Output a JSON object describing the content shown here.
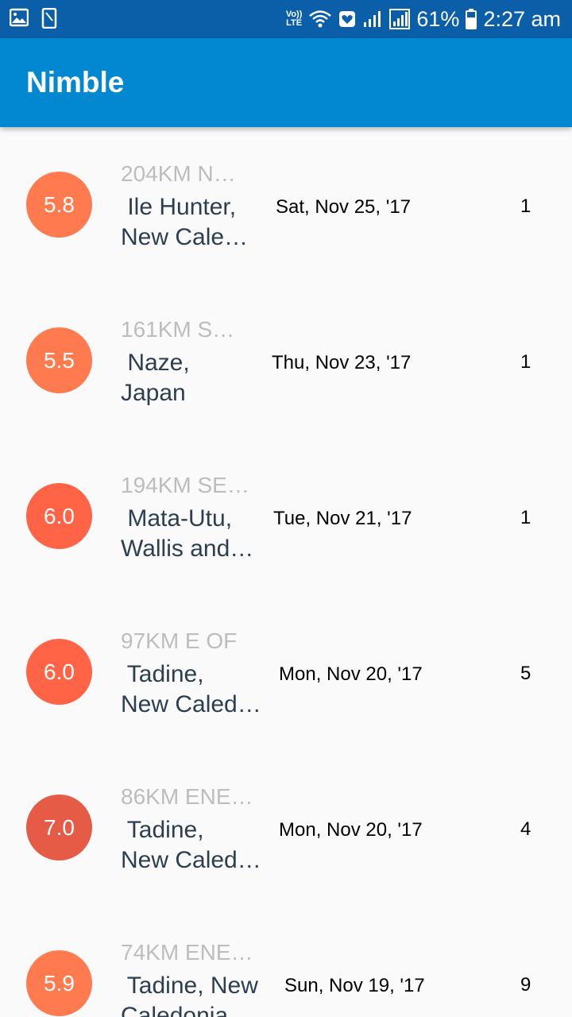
{
  "status_bar": {
    "lte_top": "Vo))",
    "lte_bottom": "LTE",
    "battery": "61%",
    "clock": "2:27 am"
  },
  "app_bar": {
    "title": "Nimble"
  },
  "quakes": [
    {
      "mag": "5.8",
      "offset": "204KM N…",
      "place_line1": " Ile Hunter,",
      "place_line2": "New Cale…",
      "date": "Sat, Nov 25, '17",
      "time": "1",
      "color": "#ff7b4f"
    },
    {
      "mag": "5.5",
      "offset": "161KM S…",
      "place_line1": " Naze,",
      "place_line2": "Japan",
      "date": "Thu, Nov 23, '17",
      "time": "1",
      "color": "#ff7b4f"
    },
    {
      "mag": "6.0",
      "offset": "194KM SE…",
      "place_line1": " Mata-Utu,",
      "place_line2": "Wallis and…",
      "date": "Tue, Nov 21, '17",
      "time": "1",
      "color": "#ff6446"
    },
    {
      "mag": "6.0",
      "offset": "97KM E OF",
      "place_line1": " Tadine,",
      "place_line2": "New Caled…",
      "date": "Mon, Nov 20, '17",
      "time": "5",
      "color": "#ff6446"
    },
    {
      "mag": "7.0",
      "offset": "86KM ENE…",
      "place_line1": " Tadine,",
      "place_line2": "New Caled…",
      "date": "Mon, Nov 20, '17",
      "time": "4",
      "color": "#e55b45"
    },
    {
      "mag": "5.9",
      "offset": "74KM ENE …",
      "place_line1": " Tadine, New",
      "place_line2": "Caledonia",
      "date": "Sun, Nov 19, '17",
      "time": "9",
      "color": "#ff7b4f"
    }
  ]
}
